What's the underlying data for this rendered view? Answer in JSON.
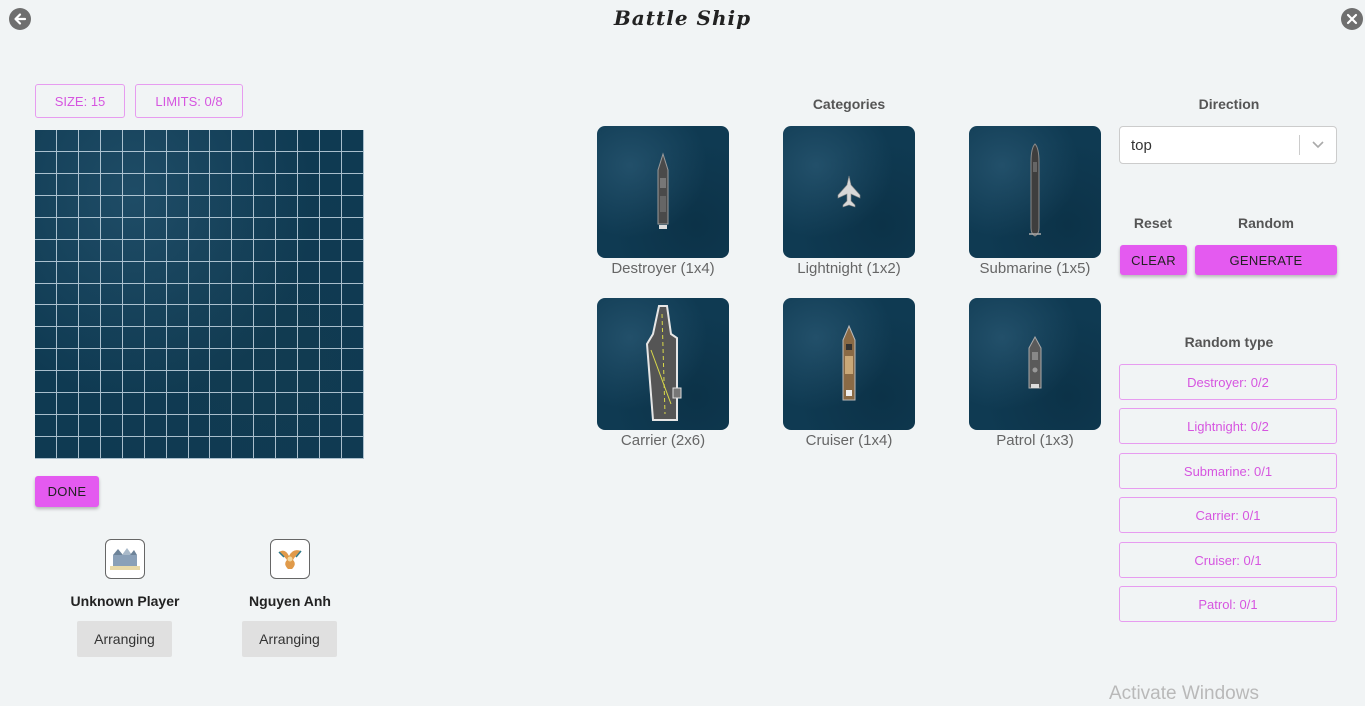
{
  "header": {
    "title": "Battle Ship"
  },
  "board": {
    "size_chip": "SIZE: 15",
    "limits_chip": "LIMITS: 0/8",
    "grid_size": 15,
    "done_label": "DONE"
  },
  "categories": {
    "heading": "Categories",
    "items": [
      {
        "label": "Destroyer (1x4)"
      },
      {
        "label": "Lightnight (1x2)"
      },
      {
        "label": "Submarine (1x5)"
      },
      {
        "label": "Carrier (2x6)"
      },
      {
        "label": "Cruiser (1x4)"
      },
      {
        "label": "Patrol (1x3)"
      }
    ]
  },
  "controls": {
    "direction_heading": "Direction",
    "direction_value": "top",
    "reset_heading": "Reset",
    "random_heading": "Random",
    "clear_label": "CLEAR",
    "generate_label": "GENERATE",
    "random_type_heading": "Random type",
    "random_types": [
      {
        "label": "Destroyer: 0/2"
      },
      {
        "label": "Lightnight: 0/2"
      },
      {
        "label": "Submarine: 0/1"
      },
      {
        "label": "Carrier: 0/1"
      },
      {
        "label": "Cruiser: 0/1"
      },
      {
        "label": "Patrol: 0/1"
      }
    ]
  },
  "players": [
    {
      "name": "Unknown Player",
      "status": "Arranging"
    },
    {
      "name": "Nguyen Anh",
      "status": "Arranging"
    }
  ],
  "watermark": "Activate Windows",
  "colors": {
    "accent": "#e45af0",
    "accent_text": "#d655e0",
    "sea": "#0f3a52",
    "background": "#f1f4f5"
  }
}
